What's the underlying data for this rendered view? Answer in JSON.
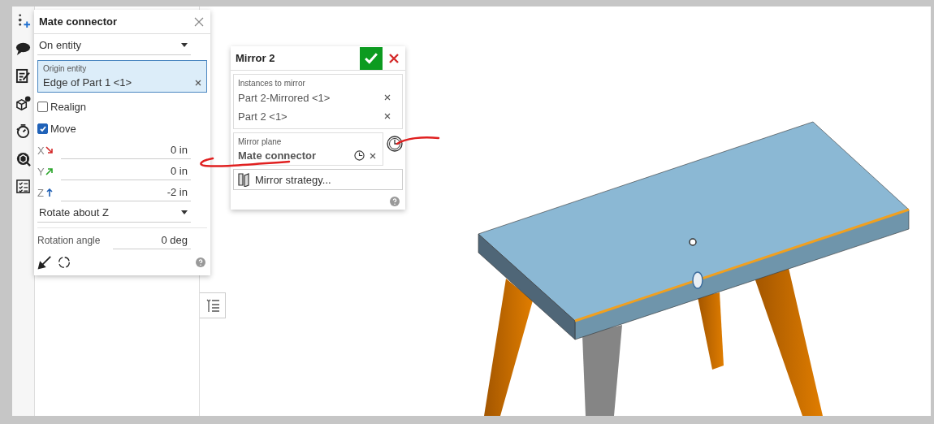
{
  "mate_connector": {
    "title": "Mate connector",
    "type_dropdown": "On entity",
    "origin_entity": {
      "label": "Origin entity",
      "value": "Edge of Part 1 <1>"
    },
    "options": [
      {
        "label": "Realign",
        "checked": false
      },
      {
        "label": "Move",
        "checked": true
      }
    ],
    "offsets": [
      {
        "axis": "X",
        "value": "0 in",
        "color": "#d42a2a"
      },
      {
        "axis": "Y",
        "value": "0 in",
        "color": "#2aa52a"
      },
      {
        "axis": "Z",
        "value": "-2 in",
        "color": "#1e5fb4"
      }
    ],
    "rotate_dropdown": "Rotate about Z",
    "rotation_angle": {
      "label": "Rotation angle",
      "value": "0 deg"
    }
  },
  "mirror": {
    "title": "Mirror 2",
    "instances": {
      "label": "Instances to mirror",
      "items": [
        "Part 2-Mirrored <1>",
        "Part 2 <1>"
      ]
    },
    "mirror_plane": {
      "label": "Mirror plane",
      "value": "Mate connector"
    },
    "strategy_button": "Mirror strategy..."
  }
}
